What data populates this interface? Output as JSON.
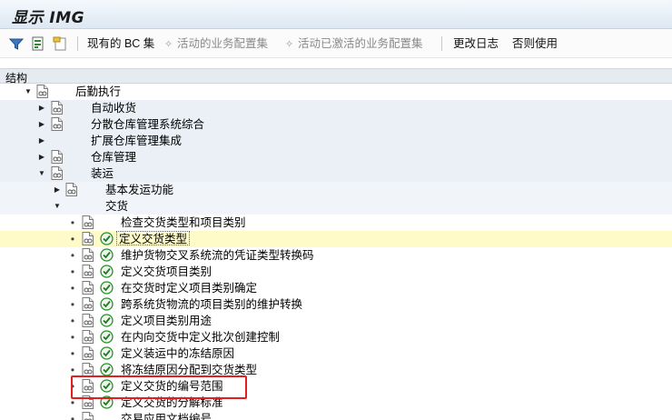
{
  "window": {
    "title": "显示 IMG"
  },
  "toolbar": {
    "btn_bc_sets": "现有的 BC 集",
    "btn_active_bc": "活动的业务配置集",
    "btn_activated_bc": "活动已激活的业务配置集",
    "btn_change_log": "更改日志",
    "btn_obsolete": "否则使用"
  },
  "tree": {
    "header": "结构",
    "items": [
      {
        "label": "后勤执行"
      },
      {
        "label": "自动收货"
      },
      {
        "label": "分散仓库管理系统综合"
      },
      {
        "label": "扩展仓库管理集成"
      },
      {
        "label": "仓库管理"
      },
      {
        "label": "装运"
      },
      {
        "label": "基本发运功能"
      },
      {
        "label": "交货"
      },
      {
        "label": "检查交货类型和项目类别"
      },
      {
        "label": "定义交货类型"
      },
      {
        "label": "维护货物交叉系统流的凭证类型转换码"
      },
      {
        "label": "定义交货项目类别"
      },
      {
        "label": "在交货时定义项目类别确定"
      },
      {
        "label": "跨系统货物流的项目类别的维护转换"
      },
      {
        "label": "定义项目类别用途"
      },
      {
        "label": "在内向交货中定义批次创建控制"
      },
      {
        "label": "定义装运中的冻结原因"
      },
      {
        "label": "将冻结原因分配到交货类型"
      },
      {
        "label": "定义交货的编号范围"
      },
      {
        "label": "定义交货的分解标准"
      },
      {
        "label": "交易应用文档编号"
      }
    ]
  },
  "colors": {
    "accent_red": "#e02020",
    "highlight": "#fffbc9",
    "header_bg": "#e6ebf1"
  }
}
